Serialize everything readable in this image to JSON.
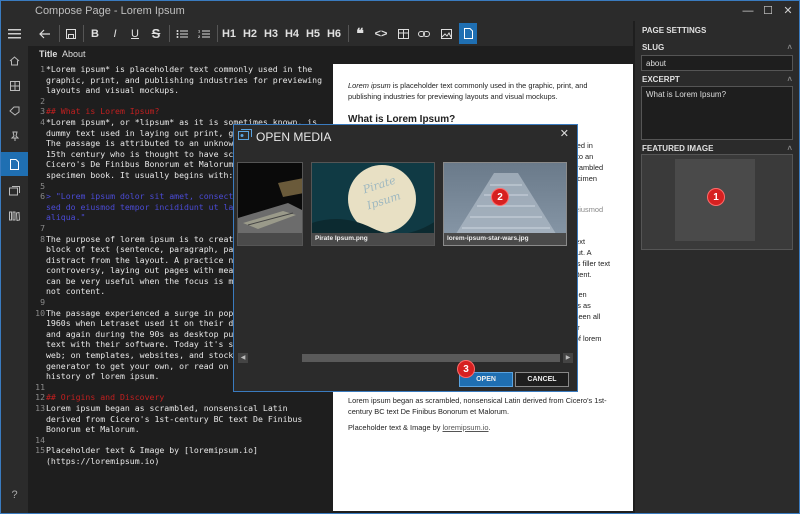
{
  "window": {
    "title": "Compose Page - Lorem Ipsum",
    "minimize": "—",
    "maximize": "☐",
    "close": "✕"
  },
  "toolbar": {
    "heading_buttons": [
      "H1",
      "H2",
      "H3",
      "H4",
      "H5",
      "H6"
    ],
    "bold": "B",
    "italic": "I",
    "underline": "U",
    "strike": "S",
    "quote": "❝",
    "code": "<>"
  },
  "tabs": {
    "title": "Title",
    "about": "About"
  },
  "editor_lines": [
    {
      "n": "1",
      "t": "*Lorem ipsum* is placeholder text commonly used in the graphic, print, and publishing industries for previewing layouts and visual mockups.",
      "c": ""
    },
    {
      "n": "2",
      "t": "",
      "c": ""
    },
    {
      "n": "3",
      "t": "## What is Lorem Ipsum?",
      "c": "red"
    },
    {
      "n": "4",
      "t": "*Lorem ipsum*, or *lipsum* as it is sometimes known, is dummy text used in laying out print, gr\nThe passage is attributed to an unknown\n15th century who is thought to have scr\nCicero's De Finibus Bonorum et Malorum\nspecimen book. It usually begins with:",
      "c": ""
    },
    {
      "n": "5",
      "t": "",
      "c": ""
    },
    {
      "n": "6",
      "t": "> \"Lorem ipsum dolor sit amet, consectet\nsed do eiusmod tempor incididunt ut lab\naliqua.\"",
      "c": "blue"
    },
    {
      "n": "7",
      "t": "",
      "c": ""
    },
    {
      "n": "8",
      "t": "The purpose of lorem ipsum is to create\nblock of text (sentence, paragraph, pag\ndistract from the layout. A practice no\ncontroversy, laying out pages with mean\ncan be very useful when the focus is me\nnot content.",
      "c": ""
    },
    {
      "n": "9",
      "t": "",
      "c": ""
    },
    {
      "n": "10",
      "t": "The passage experienced a surge in popu\n1960s when Letraset used it on their dr\nand again during the 90s as desktop pub\ntext with their software. Today it's se\nweb; on templates, websites, and stock\ngenerator to get your own, or read on f\nhistory of lorem ipsum.",
      "c": ""
    },
    {
      "n": "11",
      "t": "",
      "c": ""
    },
    {
      "n": "12",
      "t": "## Origins and Discovery",
      "c": "red"
    },
    {
      "n": "13",
      "t": "Lorem ipsum began as scrambled, nonsensical Latin derived from Cicero's 1st-century BC text De Finibus Bonorum et Malorum.",
      "c": ""
    },
    {
      "n": "14",
      "t": "",
      "c": ""
    },
    {
      "n": "15",
      "t": "Placeholder text & Image by [loremipsum.io](https://loremipsum.io)",
      "c": ""
    }
  ],
  "preview": {
    "intro_em": "Lorem ipsum",
    "intro_rest": " is placeholder text commonly used in the graphic, print, and publishing industries for previewing layouts and visual mockups.",
    "heading1": "What is Lorem Ipsum?",
    "frag_a": "used in\nin to an\nscrambled\npecimen",
    "frag_b": "o eiusmod",
    "frag_c": "f text\nyout. A\ness filler text\nontent.",
    "frag_d": "when\n90s as\ns seen all\nour\ny of lorem",
    "para_origin": "Lorem ipsum began as scrambled, nonsensical Latin derived from Cicero's 1st-century BC text De Finibus Bonorum et Malorum.",
    "credit_text": "Placeholder text & Image by ",
    "credit_link": "loremipsum.io",
    "credit_end": "."
  },
  "settings": {
    "header": "PAGE SETTINGS",
    "slug_label": "SLUG",
    "slug_value": "about",
    "excerpt_label": "EXCERPT",
    "excerpt_value": "What is Lorem Ipsum?",
    "featured_label": "FEATURED IMAGE"
  },
  "modal": {
    "title": "OPEN MEDIA",
    "close": "✕",
    "images": [
      {
        "name": ""
      },
      {
        "name": "Pirate Ipsum.png"
      },
      {
        "name": "lorem-ipsum-star-wars.jpg"
      }
    ],
    "open_label": "OPEN",
    "cancel_label": "CANCEL",
    "scroll_left": "◀",
    "scroll_right": "▶"
  },
  "badges": [
    "1",
    "2",
    "3"
  ],
  "help": "?",
  "colors": {
    "accent": "#1f6fb2",
    "badge": "#d62020",
    "heading_md": "#c02020",
    "quote_md": "#4b4bd6"
  }
}
